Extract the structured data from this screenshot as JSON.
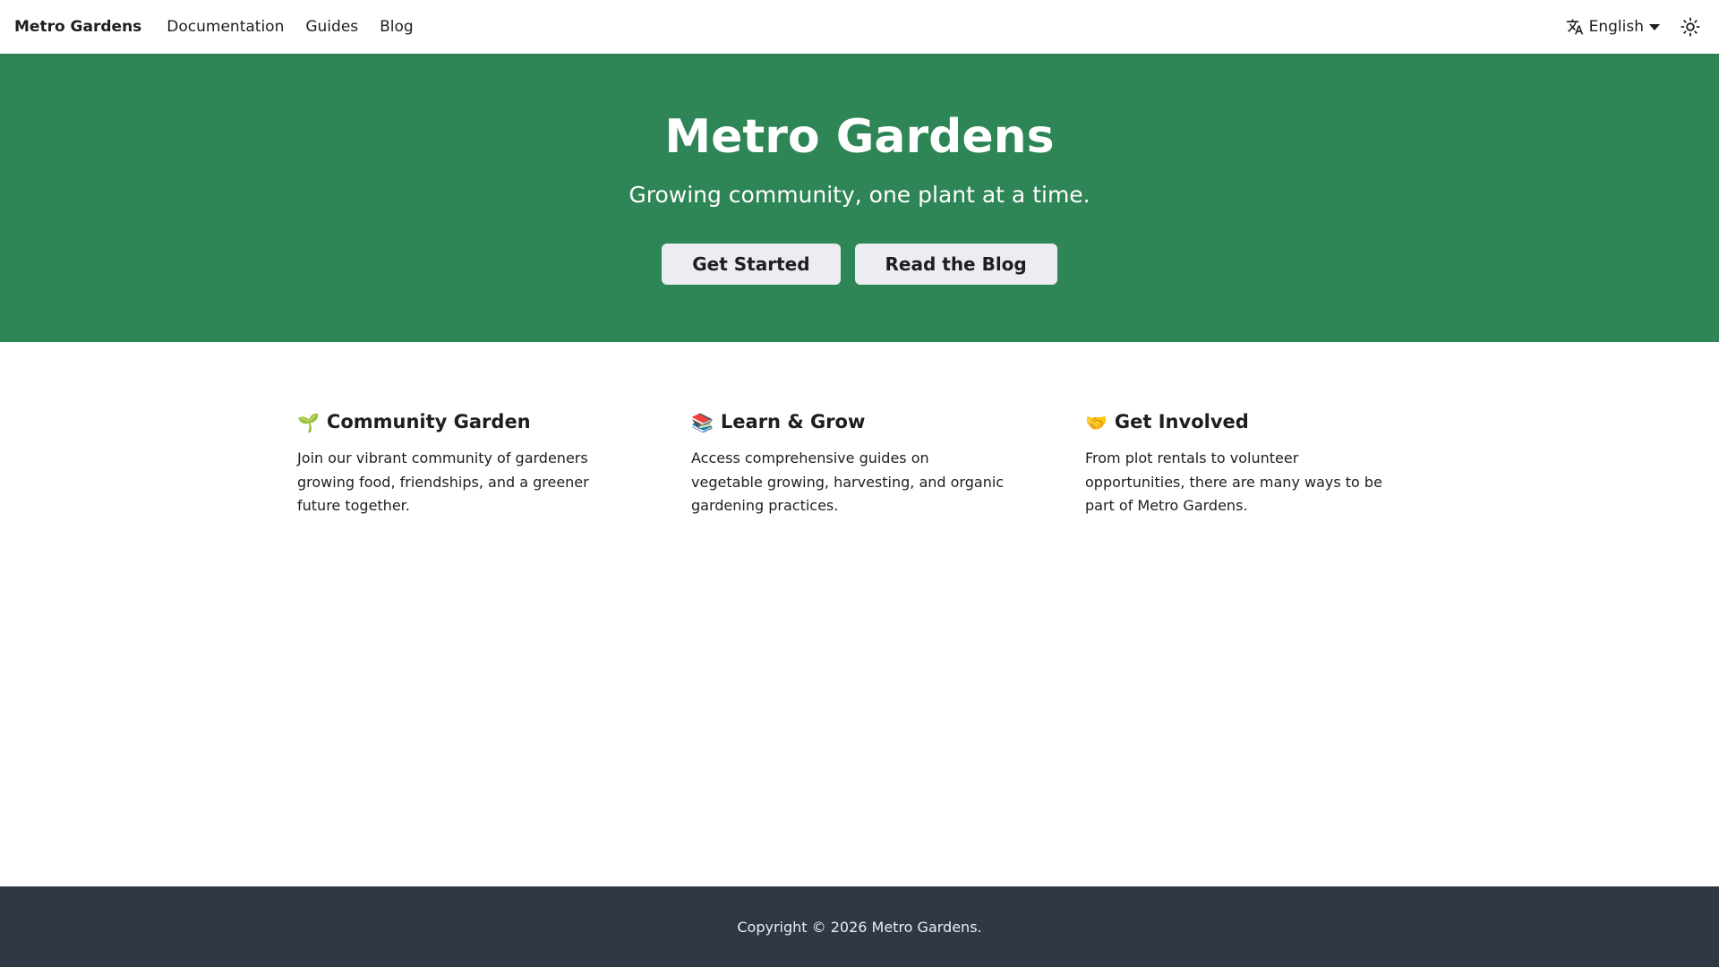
{
  "navbar": {
    "brand": "Metro Gardens",
    "links": [
      "Documentation",
      "Guides",
      "Blog"
    ],
    "language": "English"
  },
  "hero": {
    "title": "Metro Gardens",
    "subtitle": "Growing community, one plant at a time.",
    "buttons": [
      "Get Started",
      "Read the Blog"
    ],
    "background": "#2e8555"
  },
  "features": [
    {
      "emoji": "🌱",
      "title": "Community Garden",
      "text": "Join our vibrant community of gardeners growing food, friendships, and a greener future together."
    },
    {
      "emoji": "📚",
      "title": "Learn & Grow",
      "text": "Access comprehensive guides on vegetable growing, harvesting, and organic gardening practices."
    },
    {
      "emoji": "🤝",
      "title": "Get Involved",
      "text": "From plot rentals to volunteer opportunities, there are many ways to be part of Metro Gardens."
    }
  ],
  "footer": {
    "copyright": "Copyright © 2026 Metro Gardens.",
    "background": "#303846"
  },
  "icons": {
    "language": "translate-icon",
    "theme": "sun-icon"
  }
}
